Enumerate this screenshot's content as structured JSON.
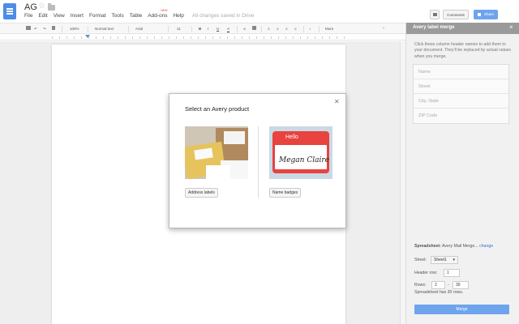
{
  "doc": {
    "title": "AG",
    "saved_status": "All changes saved in Drive"
  },
  "menu": [
    "File",
    "Edit",
    "View",
    "Insert",
    "Format",
    "Tools",
    "Table",
    "Add-ons",
    "Help"
  ],
  "menu_badge": "NEW",
  "header": {
    "comments_label": "Comments",
    "share_label": "Share"
  },
  "toolbar": {
    "zoom": "100%",
    "style": "Normal text",
    "font": "Arial",
    "size": "11",
    "more": "More"
  },
  "dialog": {
    "title": "Select an Avery product",
    "products": [
      {
        "button": "Address labels"
      },
      {
        "button": "Name badges",
        "badge_hello": "Hello",
        "badge_name": "Megan Claire"
      }
    ]
  },
  "sidebar": {
    "title": "Avery label merge",
    "intro": "Click these column header names to add them to your document. They'll be replaced by actual values when you merge.",
    "fields": [
      "Name",
      "Street",
      "City, State",
      "ZIP Code"
    ],
    "spreadsheet_label": "Spreadsheet:",
    "spreadsheet_value": "Avery Mail Merge...",
    "change_link": "change",
    "sheet_label": "Sheet:",
    "sheet_value": "Sheet1",
    "header_row_label": "Header row:",
    "header_row_value": "1",
    "rows_label": "Rows:",
    "rows_from": "2",
    "rows_dash": "-",
    "rows_to": "30",
    "rows_note": "Spreadsheet has 30 rows.",
    "merge_label": "Merge"
  },
  "colors": {
    "accent": "#6ea4ee",
    "docs_blue": "#4d8ce8",
    "sidebar_header": "#9a9a9a"
  }
}
